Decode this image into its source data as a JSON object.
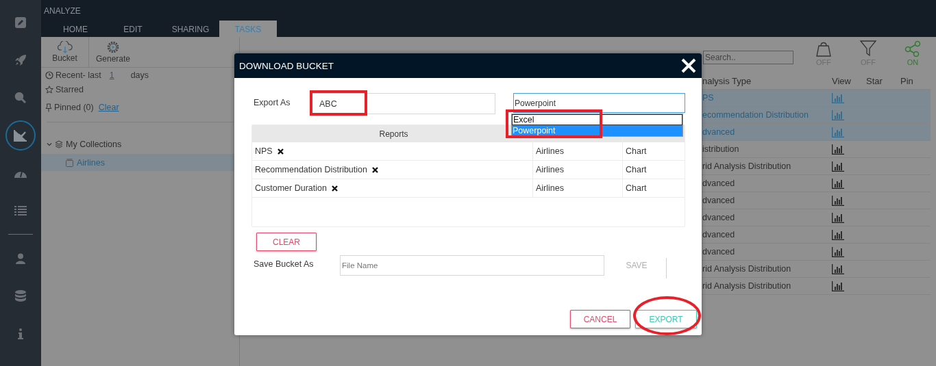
{
  "sidebar": {
    "items": [
      {
        "kind": "edit",
        "selected": false
      },
      {
        "kind": "rocket",
        "selected": false
      },
      {
        "kind": "search",
        "selected": false
      },
      {
        "kind": "chart",
        "selected": true
      },
      {
        "kind": "gauge",
        "selected": false
      },
      {
        "kind": "list",
        "selected": false
      },
      {
        "kind": "divider"
      },
      {
        "kind": "user",
        "selected": false
      },
      {
        "kind": "database",
        "selected": false
      },
      {
        "kind": "info",
        "selected": false
      }
    ]
  },
  "app": {
    "title": "ANALYZE"
  },
  "tabs": [
    {
      "label": "HOME",
      "selected": false
    },
    {
      "label": "EDIT",
      "selected": false
    },
    {
      "label": "SHARING",
      "selected": false
    },
    {
      "label": "TASKS",
      "selected": true
    }
  ],
  "toolbar": [
    {
      "label": "Bucket",
      "kind": "cloud"
    },
    {
      "label": "Generate",
      "kind": "gear"
    }
  ],
  "filters": {
    "recent_prefix": "Recent- last",
    "recent_value": "1",
    "recent_suffix": "days",
    "starred": "Starred",
    "pinned": "Pinned (0)",
    "clear_link": "Clear"
  },
  "collections": {
    "label": "My Collections",
    "expanded": true,
    "children": [
      {
        "label": "Airlines",
        "selected": true
      }
    ]
  },
  "right_panel": {
    "search": {
      "placeholder": "Search.."
    },
    "toggles": [
      {
        "kind": "bag",
        "state": "OFF",
        "on": false
      },
      {
        "kind": "filter",
        "state": "OFF",
        "on": false
      },
      {
        "kind": "share",
        "state": "ON",
        "on": true
      }
    ],
    "columns": [
      "nalysis Type",
      "View",
      "Star",
      "Pin"
    ],
    "rows": [
      {
        "name": "PS",
        "selected": true
      },
      {
        "name": "ecommendation Distribution",
        "selected": true
      },
      {
        "name": "dvanced",
        "selected": true
      },
      {
        "name": "istribution",
        "selected": false
      },
      {
        "name": "rid Analysis Distribution",
        "selected": false
      },
      {
        "name": "dvanced",
        "selected": false
      },
      {
        "name": "dvanced",
        "selected": false
      },
      {
        "name": "dvanced",
        "selected": false
      },
      {
        "name": "dvanced",
        "selected": false
      },
      {
        "name": "dvanced",
        "selected": false
      },
      {
        "name": "rid Analysis Distribution",
        "selected": false
      },
      {
        "name": "rid Analysis Distribution",
        "selected": false
      }
    ]
  },
  "dialog": {
    "title": "DOWNLOAD BUCKET",
    "export_label": "Export As",
    "export_value": "ABC",
    "format": {
      "value": "Powerpoint",
      "expanded": true,
      "options": [
        {
          "label": "Excel",
          "selected": false
        },
        {
          "label": "Powerpoint",
          "selected": true
        }
      ]
    },
    "table": {
      "columns": [
        "Reports"
      ],
      "rows": [
        {
          "report": "NPS",
          "collection": "Airlines",
          "type": "Chart"
        },
        {
          "report": "Recommendation Distribution",
          "collection": "Airlines",
          "type": "Chart"
        },
        {
          "report": "Customer Duration",
          "collection": "Airlines",
          "type": "Chart"
        }
      ]
    },
    "clear_button": "CLEAR",
    "save_label": "Save Bucket As",
    "save_placeholder": "File Name",
    "save_button": {
      "label": "SAVE",
      "disabled": true
    },
    "buttons": [
      {
        "label": "CANCEL",
        "kind": "cancel"
      },
      {
        "label": "EXPORT",
        "kind": "export"
      }
    ]
  }
}
